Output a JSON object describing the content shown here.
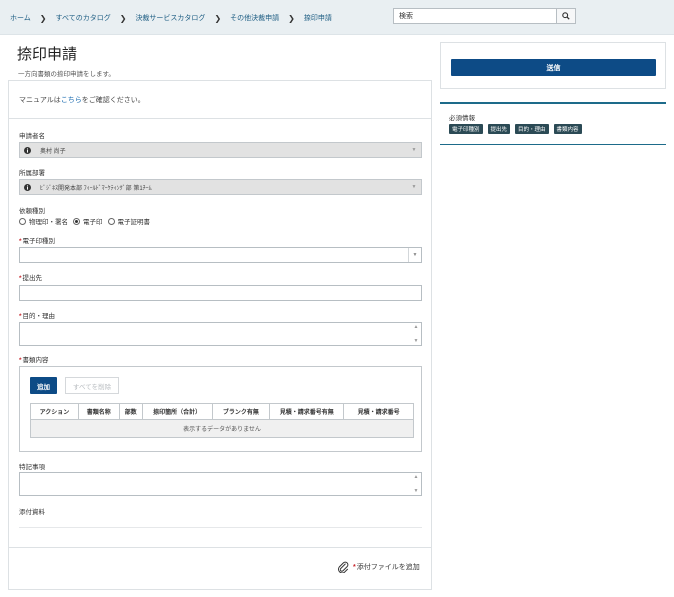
{
  "breadcrumb": [
    "ホーム",
    "すべてのカタログ",
    "決裁サービスカタログ",
    "その他決裁申請",
    "捺印申請"
  ],
  "search": {
    "value": "検索"
  },
  "page": {
    "title": "捺印申請",
    "subtitle": "一方向書類の捺印申請をします。"
  },
  "manual": {
    "prefix": "マニュアルは",
    "link": "こちら",
    "suffix": "をご確認ください。"
  },
  "fields": {
    "applicant": {
      "label": "申請者名",
      "value": "奥村 尚子"
    },
    "department": {
      "label": "所属部署",
      "value": "ﾋﾞｼﾞﾈｽ開発本部 ﾌｨｰﾙﾄﾞﾏｰｹﾃｨﾝｸﾞ部 第1ﾁｰﾑ"
    },
    "request_type": {
      "label": "依頼種別",
      "options": [
        {
          "label": "物理印・署名",
          "selected": false
        },
        {
          "label": "電子印",
          "selected": true
        },
        {
          "label": "電子証明書",
          "selected": false
        }
      ]
    },
    "seal_type": {
      "label": "電子印種別",
      "value": ""
    },
    "submit_to": {
      "label": "提出先",
      "value": ""
    },
    "purpose": {
      "label": "目的・理由",
      "value": ""
    },
    "documents": {
      "label": "書類内容",
      "add_label": "追加",
      "delete_all_label": "すべてを削除",
      "columns": [
        "アクション",
        "書類名称",
        "部数",
        "捺印箇所（合計）",
        "ブランク有無",
        "見積・請求番号有無",
        "見積・請求番号"
      ],
      "empty_text": "表示するデータがありません"
    },
    "notes": {
      "label": "特記事項",
      "value": ""
    },
    "attachments": {
      "label": "添付資料",
      "add_label": "添付ファイルを追加"
    }
  },
  "submit_label": "送信",
  "required": {
    "title": "必須情報",
    "tags": [
      "電子印種別",
      "提出先",
      "目的・理由",
      "書類内容"
    ]
  },
  "colors": {
    "primary": "#0d4b86",
    "required_mark": "#c8262c",
    "tag_bg": "#2b4a55",
    "topbar_bg": "#e9eff2"
  }
}
